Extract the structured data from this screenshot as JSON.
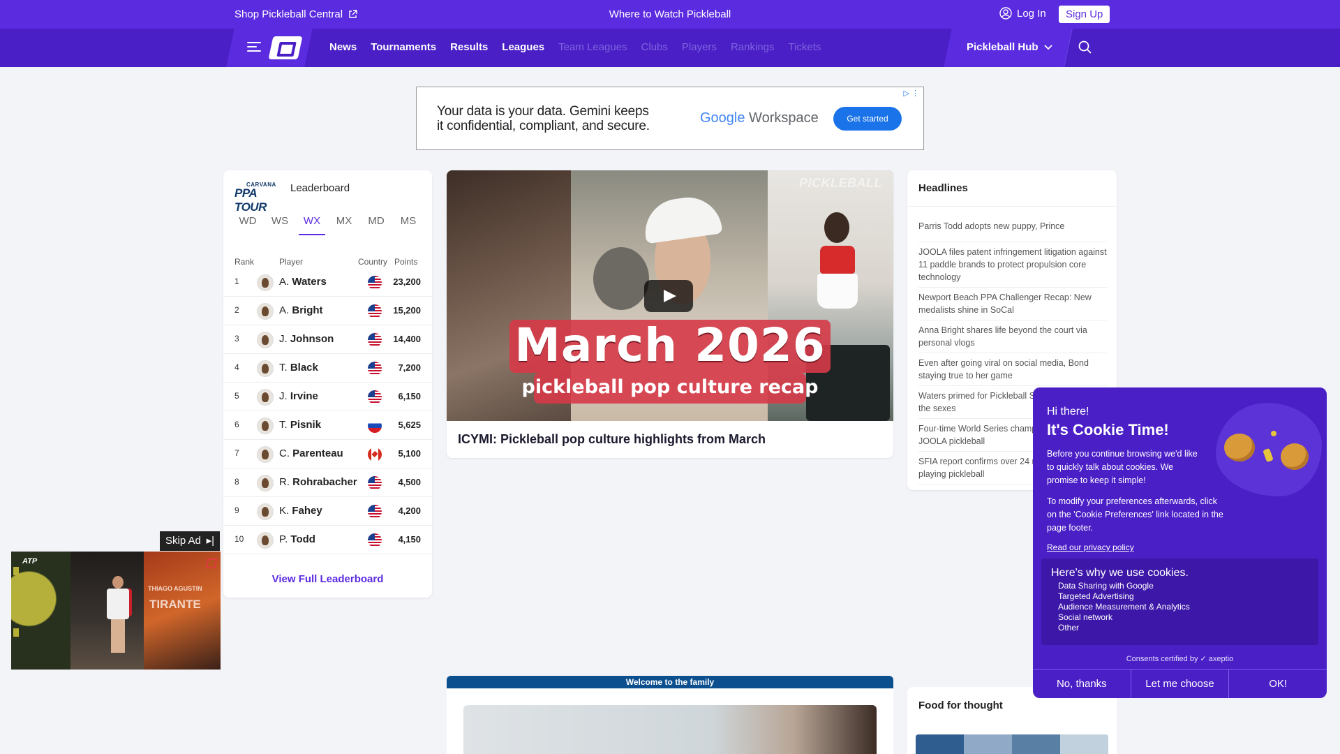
{
  "topbar": {
    "shop_label": "Shop Pickleball Central",
    "watch_label": "Where to Watch Pickleball",
    "login_label": "Log In",
    "signup_label": "Sign Up"
  },
  "nav": {
    "links": [
      {
        "label": "News",
        "active": true
      },
      {
        "label": "Tournaments",
        "active": true
      },
      {
        "label": "Results",
        "active": true
      },
      {
        "label": "Leagues",
        "active": true
      },
      {
        "label": "Team Leagues",
        "active": false
      },
      {
        "label": "Clubs",
        "active": false
      },
      {
        "label": "Players",
        "active": false
      },
      {
        "label": "Rankings",
        "active": false
      },
      {
        "label": "Tickets",
        "active": false
      }
    ],
    "hub_label": "Pickleball Hub"
  },
  "ad_banner": {
    "line1": "Your data is your data. Gemini keeps",
    "line2": "it confidential, compliant, and secure.",
    "brand_google": "Google",
    "brand_workspace": " Workspace",
    "cta": "Get started"
  },
  "leaderboard": {
    "logo_small": "CARVANA",
    "logo_big": "PPA TOUR",
    "title": "Leaderboard",
    "tabs": [
      "WD",
      "WS",
      "WX",
      "MX",
      "MD",
      "MS"
    ],
    "active_tab": "WX",
    "headers": {
      "rank": "Rank",
      "player": "Player",
      "country": "Country",
      "points": "Points"
    },
    "rows": [
      {
        "rank": "1",
        "initial": "A.",
        "last": "Waters",
        "flag": "us",
        "points": "23,200"
      },
      {
        "rank": "2",
        "initial": "A.",
        "last": "Bright",
        "flag": "us",
        "points": "15,200"
      },
      {
        "rank": "3",
        "initial": "J.",
        "last": "Johnson",
        "flag": "us",
        "points": "14,400"
      },
      {
        "rank": "4",
        "initial": "T.",
        "last": "Black",
        "flag": "us",
        "points": "7,200"
      },
      {
        "rank": "5",
        "initial": "J.",
        "last": "Irvine",
        "flag": "us",
        "points": "6,150"
      },
      {
        "rank": "6",
        "initial": "T.",
        "last": "Pisnik",
        "flag": "si",
        "points": "5,625"
      },
      {
        "rank": "7",
        "initial": "C.",
        "last": "Parenteau",
        "flag": "ca",
        "points": "5,100"
      },
      {
        "rank": "8",
        "initial": "R.",
        "last": "Rohrabacher",
        "flag": "us",
        "points": "4,500"
      },
      {
        "rank": "9",
        "initial": "K.",
        "last": "Fahey",
        "flag": "us",
        "points": "4,200"
      },
      {
        "rank": "10",
        "initial": "P.",
        "last": "Todd",
        "flag": "us",
        "points": "4,150"
      }
    ],
    "view_full": "View Full Leaderboard"
  },
  "video": {
    "watermark": "PICKLEBALL",
    "headline": "March 2026",
    "subline": "pickleball pop culture recap",
    "caption": "ICYMI: Pickleball pop culture highlights from March"
  },
  "headlines": {
    "title": "Headlines",
    "items": [
      "Parris Todd adopts new puppy, Prince",
      "JOOLA files patent infringement litigation against 11 paddle brands to protect propulsion core technology",
      "Newport Beach PPA Challenger Recap: New medalists shine in SoCal",
      "Anna Bright shares life beyond the court via personal vlogs",
      "Even after going viral on social media, Bond staying true to her game",
      "Waters primed for Pickleball Slam 4: Battle of the sexes",
      "Four-time World Series champ Martinez joins JOOLA pickleball",
      "SFIA report confirms over 24 million Americans playing pickleball"
    ]
  },
  "welcome": {
    "strip": "Welcome to the family"
  },
  "food": {
    "title": "Food for thought"
  },
  "float_ad": {
    "skip_label": "Skip Ad",
    "atp": "ATP",
    "name_small": "THIAGO AGUSTIN",
    "name_big": "TIRANTE"
  },
  "cookie": {
    "hi": "Hi there!",
    "heading": "It's Cookie Time!",
    "para1": "Before you continue browsing we'd like to quickly talk about cookies. We promise to keep it simple!",
    "para2": "To modify your preferences afterwards, click on the 'Cookie Preferences' link located in the page footer.",
    "privacy_link": "Read our privacy policy",
    "why_title": "Here's why we use cookies.",
    "reasons": [
      "Data Sharing with Google",
      "Targeted Advertising",
      "Audience Measurement & Analytics",
      "Social network",
      "Other"
    ],
    "certified": "Consents certified by ✓ axeptio",
    "btn_no": "No, thanks",
    "btn_choose": "Let me choose",
    "btn_ok": "OK!"
  }
}
